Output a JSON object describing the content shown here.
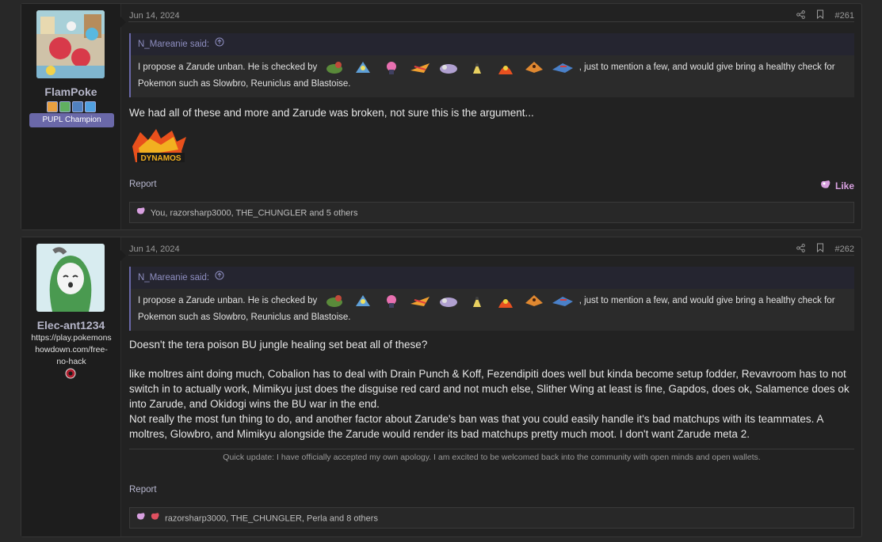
{
  "posts": [
    {
      "user": {
        "name": "FlamPoke",
        "title": "PUPL Champion"
      },
      "date": "Jun 14, 2024",
      "number": "#261",
      "quote": {
        "author": "N_Mareanie said:",
        "before_sprites": "I propose a Zarude unban. He is checked by",
        "after_sprites": ", just to mention a few, and would give bring a healthy check for",
        "line2": "Pokemon such as Slowbro, Reuniclus and Blastoise."
      },
      "body": [
        "We had all of these and more and Zarude was broken, not sure this is the argument..."
      ],
      "logo_text": "DYNAMOS",
      "report": "Report",
      "like": "Like",
      "reactions": "You, razorsharp3000, THE_CHUNGLER and 5 others"
    },
    {
      "user": {
        "name": "Elec-ant1234",
        "link_lines": [
          "https://play.pokemons",
          "howdown.com/free-",
          "no-hack"
        ]
      },
      "date": "Jun 14, 2024",
      "number": "#262",
      "quote": {
        "author": "N_Mareanie said:",
        "before_sprites": "I propose a Zarude unban. He is checked by",
        "after_sprites": ", just to mention a few, and would give bring a healthy check for",
        "line2": "Pokemon such as Slowbro, Reuniclus and Blastoise."
      },
      "body": [
        "Doesn't the tera poison BU jungle healing set beat all of these?",
        "like moltres aint doing much, Cobalion has to deal with Drain Punch & Koff, Fezendipiti does well but kinda become setup fodder, Revavroom has to not switch in to actually work, Mimikyu just does the disguise red card and not much else, Slither Wing at least is fine, Gapdos, does ok, Salamence does ok into Zarude, and Okidogi wins the BU war in the end.",
        "Not really the most fun thing to do, and another factor about Zarude's ban was that you could easily handle it's bad matchups with its teammates. A moltres, Glowbro, and Mimikyu alongside the Zarude would render its bad matchups pretty much moot. I don't want Zarude meta 2."
      ],
      "signature": "Quick update: I have officially accepted my own apology. I am excited to be welcomed back into the community with open minds and open wallets.",
      "report": "Report",
      "reactions": "razorsharp3000, THE_CHUNGLER, Perla and 8 others"
    }
  ],
  "icons": {
    "share": "share-icon",
    "bookmark": "bookmark-icon",
    "quote_arrow": "arrow-up-circle-icon",
    "like": "like-icon"
  },
  "colors": {
    "accent": "#6a68a8",
    "like": "#d8a0e0",
    "quote_author": "#8e8ec0"
  }
}
